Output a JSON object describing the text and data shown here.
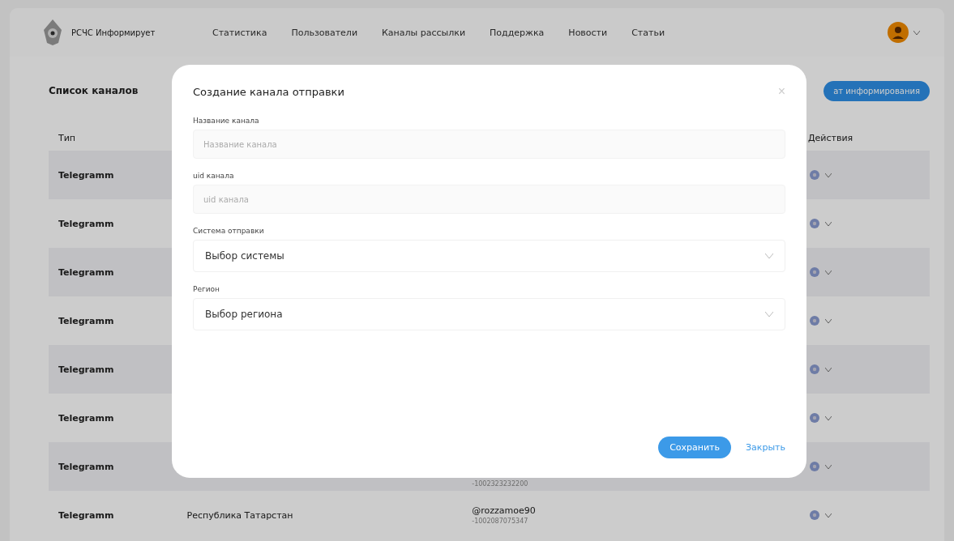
{
  "header": {
    "logo_text": "РСЧС Информирует",
    "nav": [
      "Статистика",
      "Пользователи",
      "Каналы рассылки",
      "Поддержка",
      "Новости",
      "Статьи"
    ]
  },
  "page": {
    "title": "Список каналов",
    "create_button": "ат информирования"
  },
  "table": {
    "columns": [
      "Тип",
      "Действия"
    ],
    "rows": [
      {
        "type": "Telegramm"
      },
      {
        "type": "Telegramm"
      },
      {
        "type": "Telegramm"
      },
      {
        "type": "Telegramm"
      },
      {
        "type": "Telegramm"
      },
      {
        "type": "Telegramm"
      },
      {
        "type": "Telegramm",
        "channel_id": "-1002323232200"
      },
      {
        "type": "Telegramm",
        "region": "Республика Татарстан",
        "channel": "@rozzamoe90",
        "channel_id": "-1002087075347"
      }
    ]
  },
  "modal": {
    "title": "Создание канала отправки",
    "close": "×",
    "fields": [
      {
        "kind": "input",
        "label": "Название канала",
        "placeholder": "Название канала"
      },
      {
        "kind": "input",
        "label": "uid канала",
        "placeholder": "uid канала"
      },
      {
        "kind": "select",
        "label": "Система отправки",
        "value": "Выбор системы"
      },
      {
        "kind": "select",
        "label": "Регион",
        "value": "Выбор региона"
      }
    ],
    "save_button": "Сохранить",
    "close_button": "Закрыть"
  }
}
